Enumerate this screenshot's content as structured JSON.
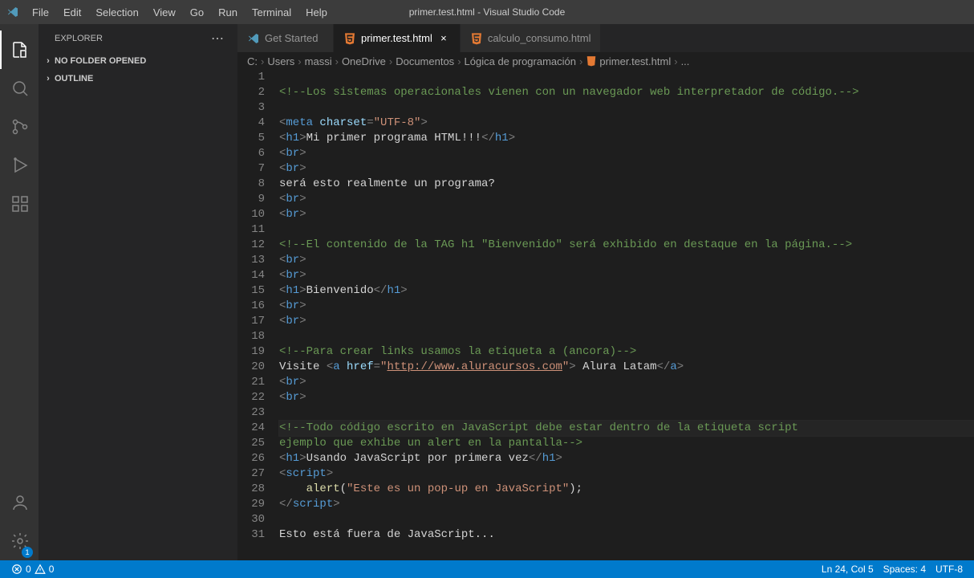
{
  "menu": [
    "File",
    "Edit",
    "Selection",
    "View",
    "Go",
    "Run",
    "Terminal",
    "Help"
  ],
  "title": "primer.test.html - Visual Studio Code",
  "sidebar": {
    "title": "EXPLORER",
    "sections": [
      "NO FOLDER OPENED",
      "OUTLINE"
    ]
  },
  "tabs": [
    {
      "label": "Get Started",
      "active": false,
      "icon": "vscode"
    },
    {
      "label": "primer.test.html",
      "active": true,
      "icon": "html",
      "close": true
    },
    {
      "label": "calculo_consumo.html",
      "active": false,
      "icon": "html"
    }
  ],
  "breadcrumb": [
    "C:",
    "Users",
    "massi",
    "OneDrive",
    "Documentos",
    "Lógica de programación",
    "primer.test.html",
    "..."
  ],
  "code": {
    "cursor_line": 24,
    "lines": [
      {
        "n": 1,
        "t": ""
      },
      {
        "n": 2,
        "t": "comment",
        "c": "<!--Los sistemas operacionales vienen con un navegador web interpretador de código.-->"
      },
      {
        "n": 3,
        "t": ""
      },
      {
        "n": 4,
        "html": "<span class='tok-tag'>&lt;</span><span class='tok-name'>meta</span> <span class='tok-attr'>charset</span><span class='tok-tag'>=</span><span class='tok-string'>\"UTF-8\"</span><span class='tok-tag'>&gt;</span>"
      },
      {
        "n": 5,
        "html": "<span class='tok-tag'>&lt;</span><span class='tok-name'>h1</span><span class='tok-tag'>&gt;</span><span class='tok-text'>Mi primer programa HTML!!!</span><span class='tok-tag'>&lt;/</span><span class='tok-name'>h1</span><span class='tok-tag'>&gt;</span>"
      },
      {
        "n": 6,
        "html": "<span class='tok-tag'>&lt;</span><span class='tok-name'>br</span><span class='tok-tag'>&gt;</span>"
      },
      {
        "n": 7,
        "html": "<span class='tok-tag'>&lt;</span><span class='tok-name'>br</span><span class='tok-tag'>&gt;</span>"
      },
      {
        "n": 8,
        "html": "<span class='tok-text'>será esto realmente un programa?</span>"
      },
      {
        "n": 9,
        "html": "<span class='tok-tag'>&lt;</span><span class='tok-name'>br</span><span class='tok-tag'>&gt;</span>"
      },
      {
        "n": 10,
        "html": "<span class='tok-tag'>&lt;</span><span class='tok-name'>br</span><span class='tok-tag'>&gt;</span>"
      },
      {
        "n": 11,
        "t": ""
      },
      {
        "n": 12,
        "t": "comment",
        "c": "<!--El contenido de la TAG h1 \"Bienvenido\" será exhibido en destaque en la página.-->"
      },
      {
        "n": 13,
        "html": "<span class='tok-tag'>&lt;</span><span class='tok-name'>br</span><span class='tok-tag'>&gt;</span>"
      },
      {
        "n": 14,
        "html": "<span class='tok-tag'>&lt;</span><span class='tok-name'>br</span><span class='tok-tag'>&gt;</span>"
      },
      {
        "n": 15,
        "html": "<span class='tok-tag'>&lt;</span><span class='tok-name'>h1</span><span class='tok-tag'>&gt;</span><span class='tok-text'>Bienvenido</span><span class='tok-tag'>&lt;/</span><span class='tok-name'>h1</span><span class='tok-tag'>&gt;</span>"
      },
      {
        "n": 16,
        "html": "<span class='tok-tag'>&lt;</span><span class='tok-name'>br</span><span class='tok-tag'>&gt;</span>"
      },
      {
        "n": 17,
        "html": "<span class='tok-tag'>&lt;</span><span class='tok-name'>br</span><span class='tok-tag'>&gt;</span>"
      },
      {
        "n": 18,
        "t": ""
      },
      {
        "n": 19,
        "t": "comment",
        "c": "<!--Para crear links usamos la etiqueta a (ancora)-->"
      },
      {
        "n": 20,
        "html": "<span class='tok-text'>Visite </span><span class='tok-tag'>&lt;</span><span class='tok-name'>a</span> <span class='tok-attr'>href</span><span class='tok-tag'>=</span><span class='tok-string'>\"</span><span class='tok-link'>http://www.aluracursos.com</span><span class='tok-string'>\"</span><span class='tok-tag'>&gt;</span><span class='tok-text'> Alura Latam</span><span class='tok-tag'>&lt;/</span><span class='tok-name'>a</span><span class='tok-tag'>&gt;</span>"
      },
      {
        "n": 21,
        "html": "<span class='tok-tag'>&lt;</span><span class='tok-name'>br</span><span class='tok-tag'>&gt;</span>"
      },
      {
        "n": 22,
        "html": "<span class='tok-tag'>&lt;</span><span class='tok-name'>br</span><span class='tok-tag'>&gt;</span>"
      },
      {
        "n": 23,
        "t": ""
      },
      {
        "n": 24,
        "t": "comment",
        "c": "<!--Todo código escrito en JavaScript debe estar dentro de la etiqueta script"
      },
      {
        "n": 25,
        "t": "comment",
        "c": "ejemplo que exhibe un alert en la pantalla-->"
      },
      {
        "n": 26,
        "html": "<span class='tok-tag'>&lt;</span><span class='tok-name'>h1</span><span class='tok-tag'>&gt;</span><span class='tok-text'>Usando JavaScript por primera vez</span><span class='tok-tag'>&lt;/</span><span class='tok-name'>h1</span><span class='tok-tag'>&gt;</span>"
      },
      {
        "n": 27,
        "html": "<span class='tok-tag'>&lt;</span><span class='tok-name'>script</span><span class='tok-tag'>&gt;</span>"
      },
      {
        "n": 28,
        "html": "    <span class='tok-func'>alert</span><span class='tok-text'>(</span><span class='tok-string'>\"Este es un pop-up en JavaScript\"</span><span class='tok-text'>);</span>"
      },
      {
        "n": 29,
        "html": "<span class='tok-tag'>&lt;/</span><span class='tok-name'>script</span><span class='tok-tag'>&gt;</span>"
      },
      {
        "n": 30,
        "t": ""
      },
      {
        "n": 31,
        "html": "<span class='tok-text'>Esto está fuera de JavaScript...</span>"
      }
    ]
  },
  "status": {
    "errors": "0",
    "warnings": "0",
    "ln_col": "Ln 24, Col 5",
    "spaces": "Spaces: 4",
    "encoding": "UTF-8"
  }
}
